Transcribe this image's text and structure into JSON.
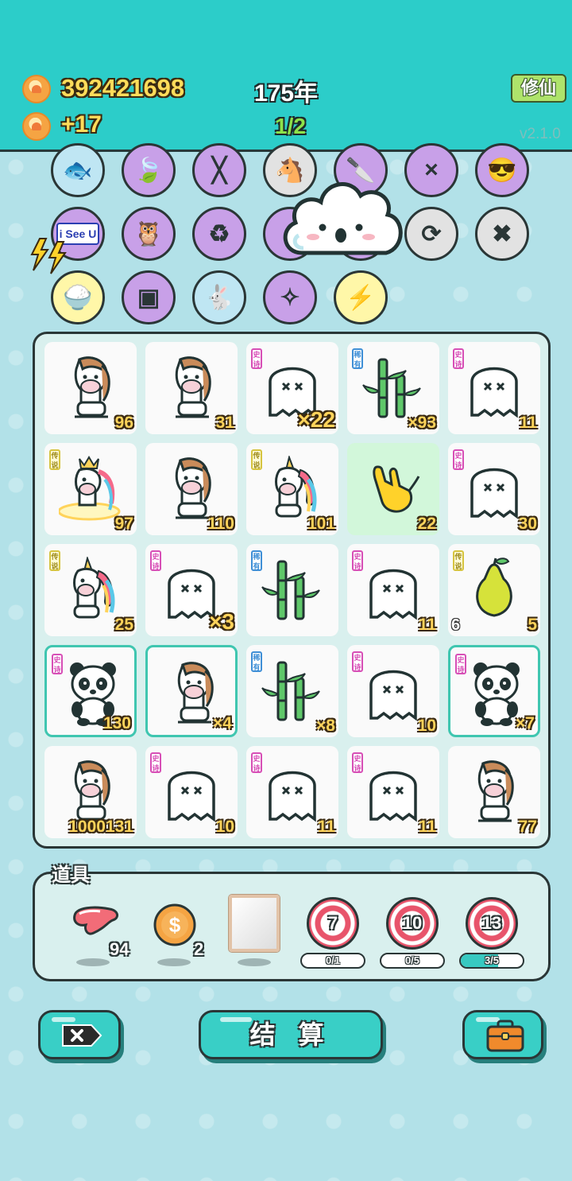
{
  "header": {
    "coins": "392421698",
    "income": "+17",
    "year": "175年",
    "stage": "1/2",
    "cultivate_button": "修仙",
    "version": "v2.1.0"
  },
  "skills": [
    {
      "name": "fishbowl",
      "icon": "fishbowl-icon",
      "color": "#bfe6f3"
    },
    {
      "name": "leaf",
      "icon": "leaf-icon",
      "color": "#c8a0e8"
    },
    {
      "name": "chopsticks",
      "icon": "chopsticks-icon",
      "color": "#c8a0e8"
    },
    {
      "name": "twin-horses",
      "icon": "twin-horses-icon",
      "color": "#e2e2e2"
    },
    {
      "name": "cleaver",
      "icon": "cleaver-icon",
      "color": "#c8a0e8"
    },
    {
      "name": "multiplier",
      "icon": "multiplier-icon",
      "color": "#c8a0e8"
    },
    {
      "name": "sunglasses-cat",
      "icon": "sunglasses-cat-icon",
      "color": "#c8a0e8"
    },
    {
      "name": "i-see-u",
      "icon": "i-see-u-icon",
      "label": "i See U",
      "color": "#c8a0e8"
    },
    {
      "name": "owl-mask",
      "icon": "owl-mask-icon",
      "color": "#c8a0e8"
    },
    {
      "name": "recycle",
      "icon": "recycle-icon",
      "color": "#c8a0e8"
    },
    {
      "name": "hidden-skill",
      "icon": "hidden-skill-icon",
      "color": "#c8a0e8"
    },
    {
      "name": "bubble-tea",
      "icon": "bubble-tea-icon",
      "color": "#c8a0e8"
    },
    {
      "name": "refresh",
      "icon": "refresh-icon",
      "color": "#e2e2e2"
    },
    {
      "name": "delete-tag",
      "icon": "delete-tag-icon",
      "color": "#e2e2e2"
    },
    {
      "name": "rice-bowl",
      "icon": "rice-bowl-icon",
      "color": "#fff7a8"
    },
    {
      "name": "jar",
      "icon": "jar-icon",
      "color": "#c8a0e8"
    },
    {
      "name": "rabbit",
      "icon": "rabbit-icon",
      "color": "#bfe6f3"
    },
    {
      "name": "compass",
      "icon": "compass-icon",
      "color": "#c8a0e8"
    },
    {
      "name": "lightning",
      "icon": "lightning-icon",
      "color": "#fff7a8"
    }
  ],
  "board": {
    "cells": [
      {
        "art": "horse",
        "value": "96"
      },
      {
        "art": "horse",
        "value": "31"
      },
      {
        "art": "ghost",
        "tag": "史诗",
        "value": "×22",
        "big": true
      },
      {
        "art": "bamboo",
        "tag": "稀有",
        "value": "×93"
      },
      {
        "art": "ghost",
        "tag": "史诗",
        "value": "11"
      },
      {
        "art": "unicorn-king",
        "tag": "传说",
        "value": "97"
      },
      {
        "art": "horse",
        "value": "110"
      },
      {
        "art": "unicorn",
        "tag": "传说",
        "value": "101"
      },
      {
        "art": "hand",
        "value": "22"
      },
      {
        "art": "ghost",
        "tag": "史诗",
        "value": "30"
      },
      {
        "art": "unicorn",
        "tag": "传说",
        "value": "25"
      },
      {
        "art": "ghost",
        "tag": "史诗",
        "value": "×3",
        "big": true
      },
      {
        "art": "bamboo",
        "tag": "稀有",
        "value": ""
      },
      {
        "art": "ghost",
        "tag": "史诗",
        "value": "11"
      },
      {
        "art": "pear",
        "tag": "传说",
        "value": "5",
        "left_value": "6"
      },
      {
        "art": "panda",
        "tag": "史诗",
        "value": "130",
        "selected": true
      },
      {
        "art": "horse",
        "value": "×4",
        "selected": true
      },
      {
        "art": "bamboo",
        "tag": "稀有",
        "value": "×8"
      },
      {
        "art": "ghost",
        "tag": "史诗",
        "value": "10"
      },
      {
        "art": "panda",
        "tag": "史诗",
        "value": "×7",
        "selected": true
      },
      {
        "art": "horse",
        "value": "1000131"
      },
      {
        "art": "ghost",
        "tag": "史诗",
        "value": "10"
      },
      {
        "art": "ghost",
        "tag": "史诗",
        "value": "11"
      },
      {
        "art": "ghost",
        "tag": "史诗",
        "value": "11"
      },
      {
        "art": "horse",
        "value": "77"
      }
    ]
  },
  "tools": {
    "label": "道具",
    "items": [
      {
        "name": "liver",
        "icon": "liver-icon",
        "count": "94"
      },
      {
        "name": "coin",
        "icon": "dollar-coin-icon",
        "count": "2"
      },
      {
        "name": "frame",
        "icon": "frame-icon",
        "count": ""
      }
    ],
    "targets": [
      {
        "value": "7",
        "progress": "0/1",
        "fraction": 0
      },
      {
        "value": "10",
        "progress": "0/5",
        "fraction": 0
      },
      {
        "value": "13",
        "progress": "3/5",
        "fraction": 0.6
      }
    ]
  },
  "buttons": {
    "remove_icon": "delete-tag-icon",
    "settle": "结 算",
    "bag_icon": "briefcase-icon"
  }
}
